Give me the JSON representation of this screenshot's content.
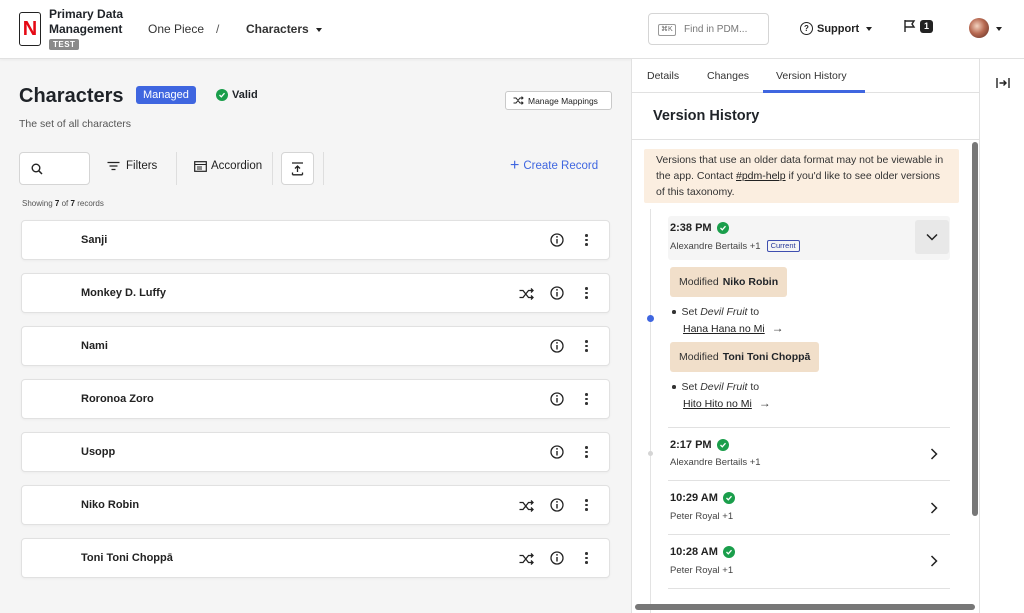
{
  "header": {
    "logo_letter": "N",
    "app_title": "Primary Data Management",
    "env_badge": "TEST",
    "breadcrumb": [
      "One Piece",
      "Characters"
    ],
    "breadcrumb_sep": "/",
    "search": {
      "shortcut": "⌘K",
      "placeholder": "Find in PDM..."
    },
    "support_label": "Support",
    "notifications_count": "1",
    "brand_color": "#e50914"
  },
  "main": {
    "title": "Characters",
    "managed_label": "Managed",
    "valid_label": "Valid",
    "manage_mappings_label": "Manage Mappings",
    "subtitle": "The set of all characters",
    "toolbar": {
      "filters_label": "Filters",
      "accordion_label": "Accordion",
      "create_label": "Create Record"
    },
    "showing": {
      "prefix": "Showing",
      "shown": "7",
      "of": "of",
      "total": "7",
      "suffix": "records"
    },
    "records": [
      {
        "name": "Sanji",
        "mapped": false
      },
      {
        "name": "Monkey D. Luffy",
        "mapped": true
      },
      {
        "name": "Nami",
        "mapped": false
      },
      {
        "name": "Roronoa Zoro",
        "mapped": false
      },
      {
        "name": "Usopp",
        "mapped": false
      },
      {
        "name": "Niko Robin",
        "mapped": true
      },
      {
        "name": "Toni Toni Choppā",
        "mapped": true
      }
    ]
  },
  "panel": {
    "tabs": [
      "Details",
      "Changes",
      "Version History"
    ],
    "active_tab": "Version History",
    "title": "Version History",
    "notice": {
      "text1": "Versions that use an older data format may not be viewable in the app. Contact",
      "link": "#pdm-help",
      "text2": "if you'd like to see older versions of this taxonomy."
    },
    "versions": [
      {
        "time": "2:38 PM",
        "author": "Alexandre Bertails +1",
        "current_label": "Current",
        "changes": [
          {
            "prefix": "Modified",
            "record": "Niko Robin",
            "set_label": "Set",
            "field": "Devil Fruit",
            "to_label": "to",
            "value": "Hana Hana no Mi"
          },
          {
            "prefix": "Modified",
            "record": "Toni Toni Choppā",
            "set_label": "Set",
            "field": "Devil Fruit",
            "to_label": "to",
            "value": "Hito Hito no Mi"
          }
        ]
      },
      {
        "time": "2:17 PM",
        "author": "Alexandre Bertails +1"
      },
      {
        "time": "10:29 AM",
        "author": "Peter Royal +1"
      },
      {
        "time": "10:28 AM",
        "author": "Peter Royal +1"
      }
    ],
    "accent_color": "#3f66e0",
    "valid_color": "#1a9e4b"
  }
}
